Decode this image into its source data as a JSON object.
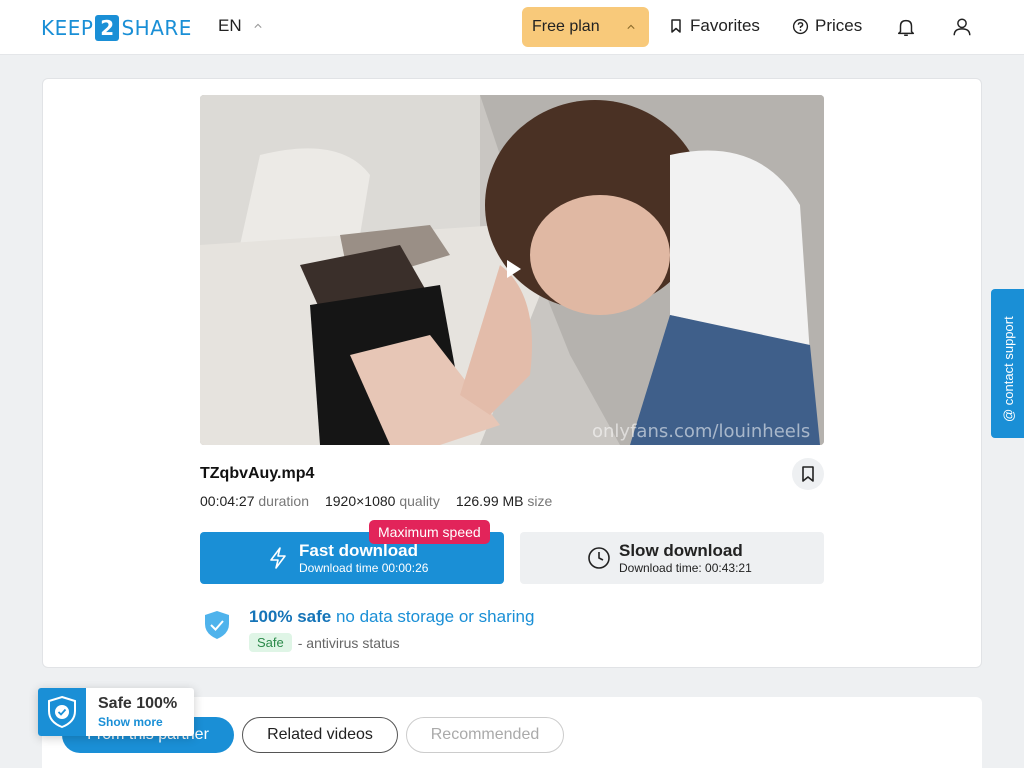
{
  "header": {
    "logo": {
      "left": "KEEP",
      "num": "2",
      "right": "SHARE"
    },
    "language": "EN",
    "plan_label": "Free plan",
    "favorites_label": "Favorites",
    "prices_label": "Prices"
  },
  "video": {
    "watermark": "onlyfans.com/louinheels"
  },
  "file": {
    "name": "TZqbvAuy.mp4",
    "duration": "00:04:27",
    "duration_label": "duration",
    "quality": "1920×1080",
    "quality_label": "quality",
    "size": "126.99 MB",
    "size_label": "size"
  },
  "download": {
    "fast_title": "Fast download",
    "fast_time": "Download time 00:00:26",
    "max_speed_badge": "Maximum speed",
    "slow_title": "Slow download",
    "slow_time": "Download time: 00:43:21"
  },
  "safety": {
    "bold": "100% safe",
    "rest": "no data storage or sharing",
    "pill": "Safe",
    "status": "- antivirus status"
  },
  "support_label": "@ contact support",
  "tabs": [
    {
      "label": "From this partner"
    },
    {
      "label": "Related videos"
    },
    {
      "label": "Recommended"
    }
  ],
  "badge": {
    "title": "Safe 100%",
    "link": "Show more"
  },
  "colors": {
    "accent": "#1a8fd6",
    "plan": "#f8c97a",
    "max_speed": "#e2245a"
  }
}
